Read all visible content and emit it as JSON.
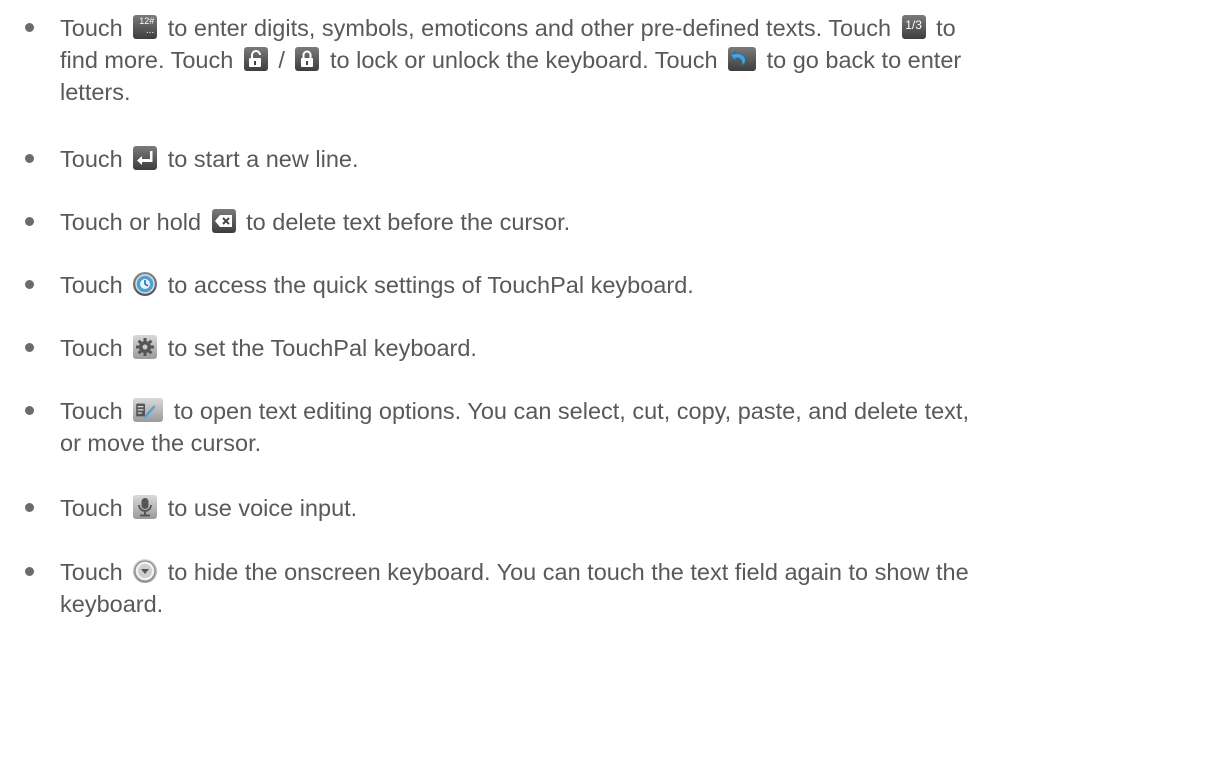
{
  "items": [
    {
      "line1a": "Touch",
      "line1b": "to enter digits, symbols, emoticons and other pre-defined texts. Touch",
      "line1c": "to",
      "line2a": "find more. Touch",
      "line2b": "/",
      "line2c": "to lock or unlock the keyboard. Touch",
      "line2d": "to go back to enter",
      "line3": "letters.",
      "icon_symbols_label": "12#",
      "icon_symbols_dots": "...",
      "icon_page_label": "1/3"
    },
    {
      "a": "Touch",
      "b": "to start a new line."
    },
    {
      "a": "Touch or hold",
      "b": "to delete text before the cursor."
    },
    {
      "a": "Touch",
      "b": "to access the quick settings of TouchPal keyboard."
    },
    {
      "a": "Touch",
      "b": "to set the TouchPal keyboard."
    },
    {
      "a": "Touch",
      "b": "to open text editing options. You can select, cut, copy, paste, and delete text,",
      "c": "or move the cursor."
    },
    {
      "a": "Touch",
      "b": "to use voice input."
    },
    {
      "a": "Touch",
      "b": "to hide the onscreen keyboard. You can touch the text field again to show the",
      "c": "keyboard."
    }
  ],
  "icons": [
    "symbols-key-icon",
    "page-indicator-icon",
    "unlock-icon",
    "lock-icon",
    "back-arrow-icon",
    "enter-key-icon",
    "delete-key-icon",
    "quick-settings-icon",
    "settings-gear-icon",
    "text-edit-icon",
    "microphone-icon",
    "hide-keyboard-icon"
  ],
  "colors": {
    "text": "#595959",
    "bullet": "#6b6b6b",
    "icon_dark": "#3d3d3d",
    "icon_accent": "#4aa0d8"
  }
}
